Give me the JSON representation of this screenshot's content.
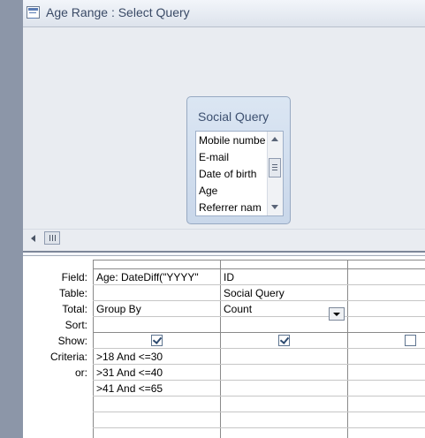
{
  "window": {
    "title": "Age Range : Select Query"
  },
  "table_box": {
    "title": "Social Query",
    "fields": [
      "Mobile numbe",
      "E-mail",
      "Date of birth",
      "Age",
      "Referrer nam"
    ]
  },
  "grid": {
    "row_labels": {
      "field": "Field:",
      "table": "Table:",
      "total": "Total:",
      "sort": "Sort:",
      "show": "Show:",
      "criteria": "Criteria:",
      "or": "or:"
    },
    "columns": [
      {
        "field": "Age: DateDiff(\"YYYY\"",
        "table": "",
        "total": "Group By",
        "sort": "",
        "show": true,
        "criteria": ">18 And <=30",
        "or": [
          ">31 And <=40",
          ">41 And <=65"
        ]
      },
      {
        "field": "ID",
        "table": "Social Query",
        "total": "Count",
        "sort": "",
        "show": true,
        "criteria": "",
        "or": [
          "",
          ""
        ]
      },
      {
        "field": "",
        "table": "",
        "total": "",
        "sort": "",
        "show": false,
        "criteria": "",
        "or": [
          "",
          ""
        ]
      }
    ]
  }
}
